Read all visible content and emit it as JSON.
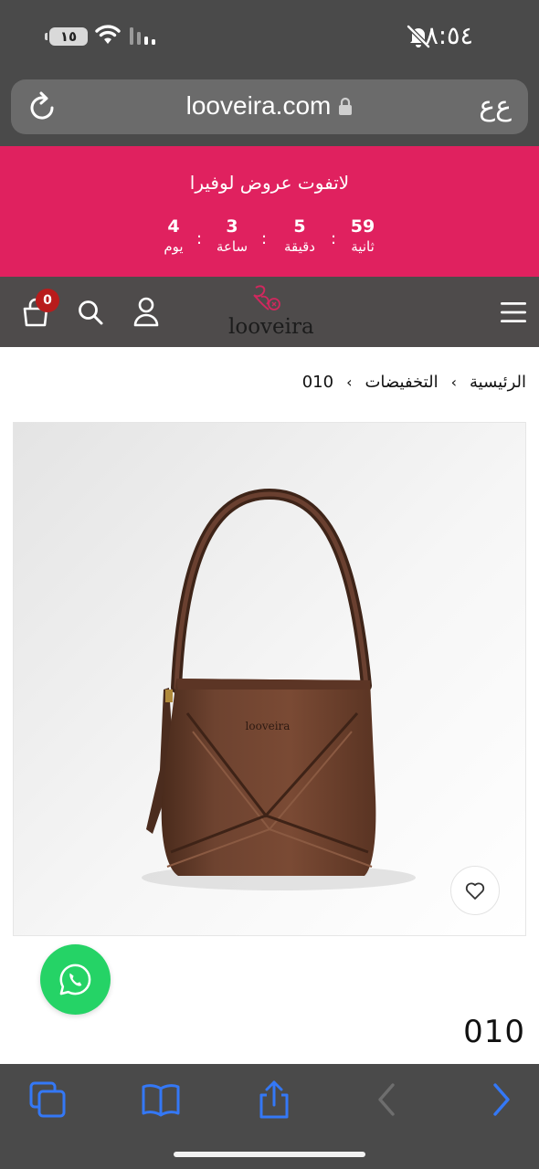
{
  "status_bar": {
    "time": "٨:٥٤",
    "battery_level": "١٥"
  },
  "browser": {
    "url": "looveira.com",
    "text_size_label": "ﻉﻉ"
  },
  "promo": {
    "title": "لاتفوت عروض لوفيرا",
    "timer": [
      {
        "value": "59",
        "label": "ثانية"
      },
      {
        "value": "5",
        "label": "دقيقة"
      },
      {
        "value": "3",
        "label": "ساعة"
      },
      {
        "value": "4",
        "label": "يوم"
      }
    ]
  },
  "header": {
    "cart_count": "0",
    "logo_text": "looveira"
  },
  "breadcrumb": {
    "items": [
      "الرئيسية",
      "التخفيضات",
      "010"
    ]
  },
  "product": {
    "image_logo_text": "looveira",
    "title": "010"
  },
  "colors": {
    "promo_bg": "#e0215f",
    "header_bg": "#4e4b4b",
    "chrome_bg": "#4a4a4a",
    "toolbar_accent": "#3478f6",
    "whatsapp": "#25d366"
  },
  "icons": {
    "toolbar": [
      "tabs-icon",
      "bookmarks-icon",
      "share-icon",
      "back-icon",
      "forward-icon"
    ]
  }
}
